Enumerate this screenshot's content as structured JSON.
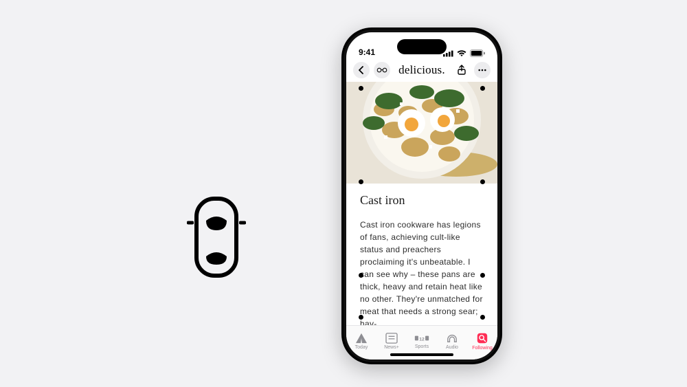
{
  "statusbar": {
    "time": "9:41"
  },
  "navbar": {
    "title": "delicious."
  },
  "article": {
    "heading": "Cast iron",
    "body": "Cast iron cookware has legions of fans, achieving cult-like status and preachers proclaiming it's unbeatable. I can see why – these pans are thick, heavy and retain heat like no other. They're unmatched for meat that needs a strong sear; hav-"
  },
  "tabs": {
    "today": "Today",
    "news": "News+",
    "sports": "Sports",
    "audio": "Audio",
    "following": "Following"
  }
}
